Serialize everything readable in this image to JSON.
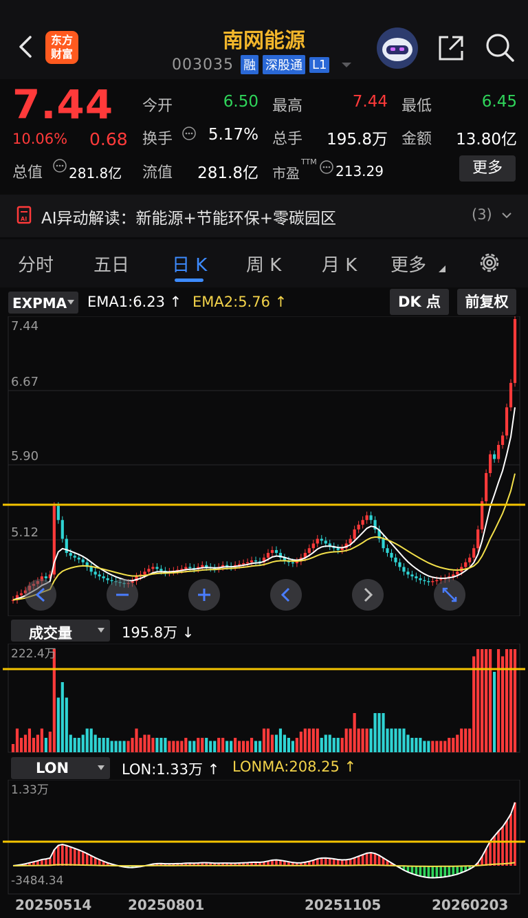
{
  "header": {
    "title": "南网能源",
    "code": "003035",
    "tags": [
      "融",
      "深股通",
      "L1"
    ],
    "logo_text": [
      "东方",
      "财富"
    ]
  },
  "quote": {
    "price": "7.44",
    "change_pct": "10.06%",
    "change_amt": "0.68",
    "open_label": "今开",
    "open": "6.50",
    "high_label": "最高",
    "high": "7.44",
    "low_label": "最低",
    "low": "6.45",
    "turnover_label": "换手",
    "turnover": "5.17%",
    "volume_label": "总手",
    "volume": "195.8万",
    "amount_label": "金额",
    "amount": "13.80亿",
    "mktcap_label": "总值",
    "mktcap": "281.8亿",
    "float_label": "流值",
    "float": "281.8亿",
    "pe_label": "市盈",
    "pe_sup": "TTM",
    "pe": "213.29",
    "more_label": "更多"
  },
  "ai": {
    "text": "AI异动解读：新能源+节能环保+零碳园区",
    "count": "(3)"
  },
  "tabs": [
    "分时",
    "五日",
    "日 K",
    "周 K",
    "月 K",
    "更多"
  ],
  "indicator_bar": {
    "selector": "EXPMA",
    "ema1": "EMA1:6.23",
    "ema2": "EMA2:5.76",
    "dk_label": "DK 点",
    "fq_label": "前复权"
  },
  "price_axis": [
    "7.44",
    "6.67",
    "5.90",
    "5.12"
  ],
  "volume_bar": {
    "selector": "成交量",
    "value": "195.8万",
    "axis_top": "222.4万"
  },
  "lon_bar": {
    "selector": "LON",
    "lon": "LON:1.33万",
    "lonma": "LONMA:208.25",
    "axis_top": "1.33万",
    "axis_bottom": "-3484.34"
  },
  "dates": [
    "20250514",
    "20250801",
    "20251105",
    "20260203"
  ],
  "colors": {
    "up": "#ff3a3a",
    "down": "#2fd4d4",
    "accent": "#f3b62b",
    "ema1": "#ffffff",
    "ema2": "#f3e04a",
    "hline": "#f5c400",
    "tab_active": "#3d8bff"
  },
  "chart_data": {
    "type": "candlestick",
    "x_range": [
      "20250514",
      "20260203"
    ],
    "price_ylim": [
      4.35,
      7.44
    ],
    "candles_close": [
      4.45,
      4.5,
      4.52,
      4.55,
      4.6,
      4.62,
      4.65,
      4.7,
      4.68,
      4.72,
      5.45,
      5.3,
      5.1,
      4.95,
      4.92,
      4.9,
      4.88,
      4.85,
      4.8,
      4.75,
      4.72,
      4.7,
      4.68,
      4.66,
      4.65,
      4.64,
      4.63,
      4.62,
      4.63,
      4.65,
      4.7,
      4.72,
      4.75,
      4.78,
      4.8,
      4.78,
      4.76,
      4.74,
      4.75,
      4.76,
      4.77,
      4.78,
      4.8,
      4.79,
      4.78,
      4.8,
      4.82,
      4.8,
      4.79,
      4.78,
      4.8,
      4.82,
      4.81,
      4.8,
      4.82,
      4.83,
      4.84,
      4.85,
      4.87,
      4.86,
      4.85,
      4.9,
      4.95,
      4.98,
      4.95,
      4.9,
      4.87,
      4.85,
      4.84,
      4.86,
      4.9,
      4.95,
      5.0,
      5.05,
      5.1,
      5.08,
      5.05,
      5.02,
      5.0,
      4.98,
      5.0,
      5.05,
      5.1,
      5.2,
      5.25,
      5.3,
      5.35,
      5.3,
      5.2,
      5.1,
      5.0,
      4.95,
      4.9,
      4.85,
      4.8,
      4.75,
      4.72,
      4.7,
      4.68,
      4.66,
      4.65,
      4.64,
      4.65,
      4.66,
      4.67,
      4.68,
      4.7,
      4.72,
      4.75,
      4.8,
      4.85,
      4.9,
      5.0,
      5.2,
      5.5,
      5.8,
      6.0,
      5.95,
      6.1,
      6.2,
      6.5,
      6.76,
      7.44
    ]
  }
}
